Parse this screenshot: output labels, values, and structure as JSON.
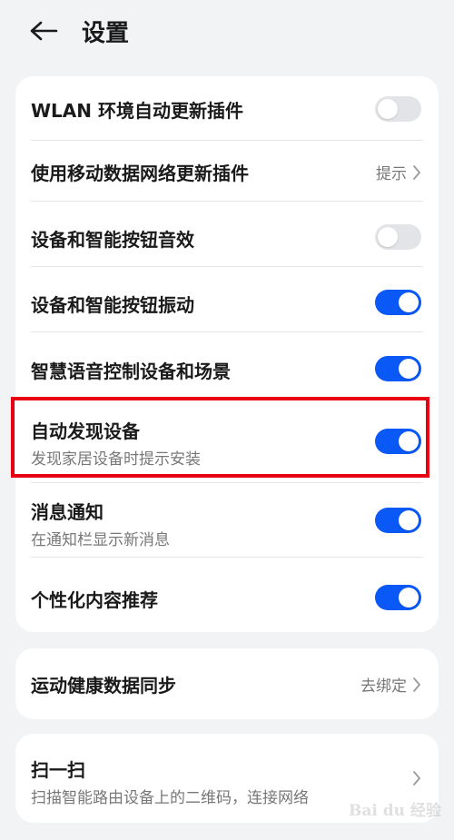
{
  "header": {
    "title": "设置"
  },
  "settings": {
    "wlan_auto_update": {
      "label": "WLAN 环境自动更新插件",
      "on": false
    },
    "mobile_data_update": {
      "label": "使用移动数据网络更新插件",
      "value": "提示"
    },
    "button_sound": {
      "label": "设备和智能按钮音效",
      "on": false
    },
    "button_vibration": {
      "label": "设备和智能按钮振动",
      "on": true
    },
    "voice_control": {
      "label": "智慧语音控制设备和场景",
      "on": true
    },
    "auto_discover": {
      "label": "自动发现设备",
      "sublabel": "发现家居设备时提示安装",
      "on": true
    },
    "notifications": {
      "label": "消息通知",
      "sublabel": "在通知栏显示新消息",
      "on": true
    },
    "personalized": {
      "label": "个性化内容推荐",
      "on": true
    }
  },
  "health_sync": {
    "label": "运动健康数据同步",
    "value": "去绑定"
  },
  "scan": {
    "label": "扫一扫",
    "sublabel": "扫描智能路由设备上的二维码，连接网络"
  },
  "watermark": {
    "text": "Bai du 经验"
  },
  "colors": {
    "switch_on": "#0a59f7",
    "switch_off": "#e2e4e7",
    "highlight": "#e60012",
    "background": "#f1f3f5"
  }
}
